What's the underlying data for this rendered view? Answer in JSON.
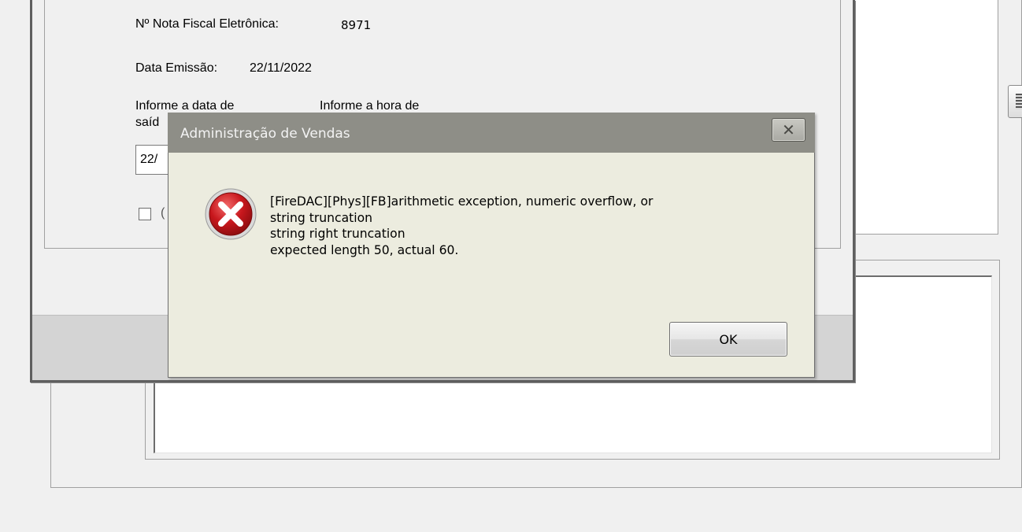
{
  "nfe_form": {
    "nota_fiscal_label": "Nº Nota Fiscal Eletrônica:",
    "nota_fiscal_value": "8971",
    "data_emissao_label": "Data Emissão:",
    "data_emissao_value": "22/11/2022",
    "data_saida_label_line1": "Informe a data de",
    "data_saida_label_line2": "saíd",
    "hora_saida_label_line1": "Informe a hora de",
    "data_saida_input_value": "22/",
    "checkbox_label_fragment": "("
  },
  "dialog": {
    "title": "Administração de Vendas",
    "close_glyph": "✕",
    "icon": "error-icon",
    "message_lines": [
      "[FireDAC][Phys][FB]arithmetic exception, numeric overflow, or",
      "string truncation",
      "string right truncation",
      "expected length 50, actual 60."
    ],
    "ok_label": "OK"
  },
  "colors": {
    "dialog_titlebar": "#8e8e87",
    "dialog_body": "#ececdf",
    "error_red": "#c8171d",
    "window_background": "#f0f0f0"
  }
}
